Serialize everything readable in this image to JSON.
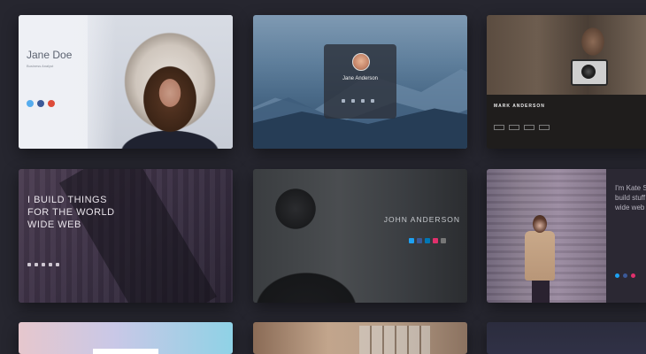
{
  "cards": {
    "card1": {
      "name": "Jane Doe",
      "role": "Business Analyst",
      "bio": "",
      "social_colors": [
        "#55acee",
        "#3b5998",
        "#dd4b39"
      ],
      "social_icons": [
        "twitter-icon",
        "facebook-icon",
        "google-plus-icon"
      ]
    },
    "card2": {
      "name": "Jane Anderson",
      "role": "",
      "social_icons": [
        "twitter-icon",
        "facebook-icon",
        "instagram-icon",
        "email-icon"
      ]
    },
    "card3": {
      "name": "MARK ANDERSON",
      "sub": "",
      "tags": [
        "",
        "",
        "",
        ""
      ]
    },
    "card4": {
      "title": "I BUILD THINGS FOR THE WORLD WIDE WEB",
      "lines": "",
      "social_icons": [
        "twitter-icon",
        "facebook-icon",
        "github-icon",
        "dribbble-icon",
        "instagram-icon"
      ]
    },
    "card5": {
      "name": "JOHN ANDERSON",
      "sub": "",
      "social_colors": [
        "#1da1f2",
        "#3b5998",
        "#0077b5",
        "#e1306c",
        "#777777"
      ],
      "social_icons": [
        "twitter-icon",
        "facebook-icon",
        "linkedin-icon",
        "instagram-icon",
        "email-icon"
      ]
    },
    "card6": {
      "title": "I'm Kate S build stuff wide web",
      "lines": "",
      "social_colors": [
        "#1da1f2",
        "#3b5998",
        "#e1306c"
      ],
      "social_icons": [
        "twitter-icon",
        "facebook-icon",
        "instagram-icon"
      ]
    }
  }
}
